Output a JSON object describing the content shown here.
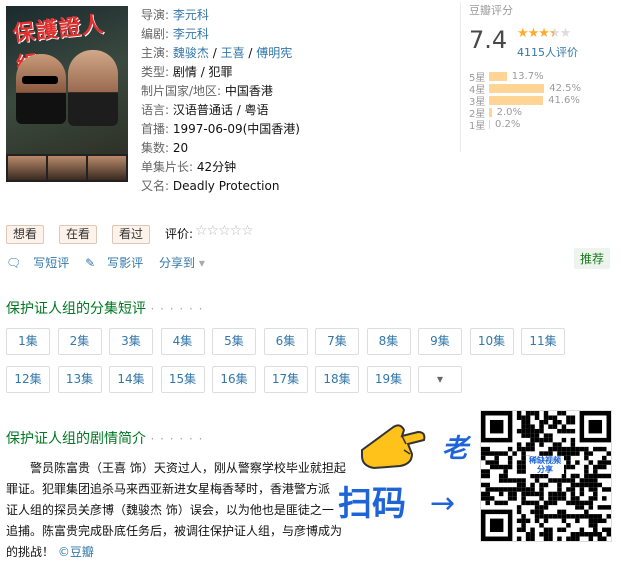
{
  "info": {
    "director": {
      "label": "导演:",
      "value": "李元科"
    },
    "writer": {
      "label": "编剧:",
      "value": "李元科"
    },
    "cast": {
      "label": "主演:",
      "values": [
        "魏骏杰",
        "王喜",
        "傅明宪"
      ],
      "sep": " / "
    },
    "genre": {
      "label": "类型:",
      "value": "剧情 / 犯罪"
    },
    "country": {
      "label": "制片国家/地区:",
      "value": "中国香港"
    },
    "language": {
      "label": "语言:",
      "value": "汉语普通话 / 粤语"
    },
    "premiere": {
      "label": "首播:",
      "value": "1997-06-09(中国香港)"
    },
    "episodes": {
      "label": "集数:",
      "value": "20"
    },
    "runtime": {
      "label": "单集片长:",
      "value": "42分钟"
    },
    "aka": {
      "label": "又名:",
      "value": "Deadly Protection"
    }
  },
  "poster": {
    "title": "保護證人組"
  },
  "rating": {
    "label": "豆瓣评分",
    "score": "7.4",
    "stars": 3.5,
    "votes": "4115人评价",
    "breakdown": [
      {
        "label": "5星",
        "pct": "13.7%",
        "value": 13.7
      },
      {
        "label": "4星",
        "pct": "42.5%",
        "value": 42.5
      },
      {
        "label": "3星",
        "pct": "41.6%",
        "value": 41.6
      },
      {
        "label": "2星",
        "pct": "2.0%",
        "value": 2.0
      },
      {
        "label": "1星",
        "pct": "0.2%",
        "value": 0.2
      }
    ]
  },
  "actions": {
    "want": "想看",
    "watching": "在看",
    "watched": "看过",
    "rate_label": "评价:",
    "rate_stars": "☆☆☆☆☆"
  },
  "share": {
    "short_review": "写短评",
    "review": "写影评",
    "share_to": "分享到",
    "recommend": "推荐"
  },
  "episode_section": {
    "title": "保护证人组的分集短评",
    "dots": "· · · · · ·",
    "episodes": [
      "1集",
      "2集",
      "3集",
      "4集",
      "5集",
      "6集",
      "7集",
      "8集",
      "9集",
      "10集",
      "11集",
      "12集",
      "13集",
      "14集",
      "15集",
      "16集",
      "17集",
      "18集",
      "19集"
    ],
    "more": "▾"
  },
  "synopsis_section": {
    "title": "保护证人组的剧情简介",
    "dots": "· · · · · ·",
    "lines": [
      "警员陈富贵（王喜 饰）天资过人，刚从警察学校毕业就担起",
      "罪证。犯罪集团追杀马来西亚新进女星梅香琴时，香港警方派",
      "证人组的探员关彦博（魏骏杰 饰）误会，以为他也是匪徒之一",
      "追捕。陈富贵完成卧底任务后，被调往保护证人组，与彦博成为",
      "的挑战！"
    ],
    "source": "©豆瓣"
  },
  "overlay": {
    "scan": "扫码",
    "arrow": "→",
    "lao": "老",
    "qr_label": "稀缺视频分享"
  },
  "colors": {
    "link": "#3377aa",
    "section_green": "#007722",
    "star": "#ffac2d",
    "bar": "#ffd596",
    "accent_blue": "#1f64d6"
  }
}
